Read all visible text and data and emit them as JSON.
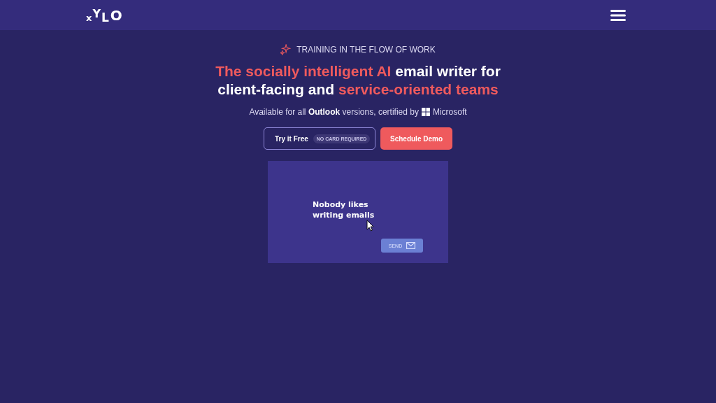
{
  "header": {
    "logo": "xYLO"
  },
  "eyebrow": "TRAINING IN THE FLOW OF WORK",
  "headline": [
    {
      "text": "The socially intelligent AI",
      "accent": true
    },
    {
      "text": "email writer for client-facing and",
      "accent": false
    },
    {
      "text": "service-oriented teams",
      "accent": true
    }
  ],
  "subtitle": {
    "text": "Available for all **Outlook** versions, certified by",
    "brand": "Microsoft"
  },
  "buttons": [
    {
      "kind": "outline",
      "label": "Try it Free",
      "badge": "NO CARD REQUIRED"
    },
    {
      "kind": "solid",
      "label": "Schedule Demo"
    }
  ],
  "demo": {
    "message": "Nobody likes writing emails",
    "send": "SEND"
  }
}
